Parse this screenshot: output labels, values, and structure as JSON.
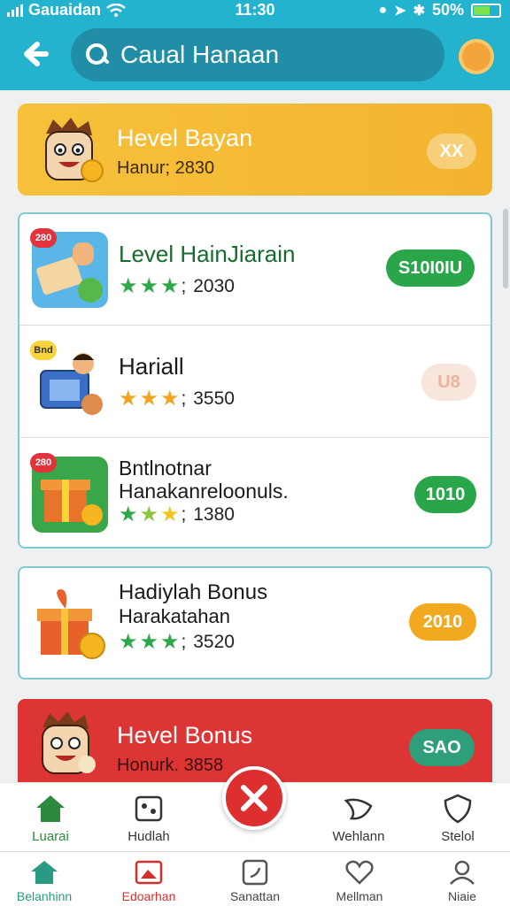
{
  "status": {
    "carrier": "Gauaidan",
    "time": "11:30",
    "battery": "50%"
  },
  "header": {
    "search_value": "Caual Hanaan"
  },
  "featured": {
    "title": "Hevel Bayan",
    "subtitle": "Hanur; 2830",
    "action": "XX"
  },
  "group_items": [
    {
      "tag": "280",
      "name": "Level HainJiarain",
      "stars": 3,
      "rating_text": "2030",
      "pill": "S10I0IU",
      "pill_color": "#2aa64a"
    },
    {
      "tag": "Bnd",
      "name": "Hariall",
      "stars": 3,
      "rating_text": "3550",
      "pill": "U8",
      "pill_color": "#f7e4d8"
    },
    {
      "tag": "280",
      "name": "Bntlnotnar",
      "name_line2": "Hanakanreloonuls.",
      "stars": 3,
      "rating_text": "1380",
      "pill": "1010",
      "pill_color": "#2aa64a"
    }
  ],
  "card2": {
    "name": "Hadiylah Bonus",
    "name_line2": "Harakatahan",
    "stars": 3,
    "rating_text": "3520",
    "pill": "2010",
    "pill_color": "#f2a91f"
  },
  "card3": {
    "title": "Hevel Bonus",
    "subtitle": "Honurk. 3858",
    "pill": "SAO",
    "pill_color": "#2f9e7b"
  },
  "subnav": [
    {
      "label": "Luarai",
      "icon": "home-icon",
      "active": true
    },
    {
      "label": "Hudlah",
      "icon": "game-icon",
      "active": false
    },
    {
      "label": "Wehlann",
      "icon": "bird-icon",
      "active": false
    },
    {
      "label": "Stelol",
      "icon": "shield-icon",
      "active": false
    }
  ],
  "tabbar": [
    {
      "label": "Belanhinn",
      "icon": "home-icon",
      "color": "#2b9a85"
    },
    {
      "label": "Edoarhan",
      "icon": "image-icon",
      "color": "#d32f2f"
    },
    {
      "label": "Sanattan",
      "icon": "note-icon",
      "color": "#555555"
    },
    {
      "label": "Mellman",
      "icon": "heart-icon",
      "color": "#555555"
    },
    {
      "label": "Niaie",
      "icon": "profile-icon",
      "color": "#555555"
    }
  ],
  "colors": {
    "header": "#23b3cf",
    "accent_green": "#2aa64a",
    "accent_red": "#dd3434",
    "accent_orange": "#f7c13a"
  }
}
